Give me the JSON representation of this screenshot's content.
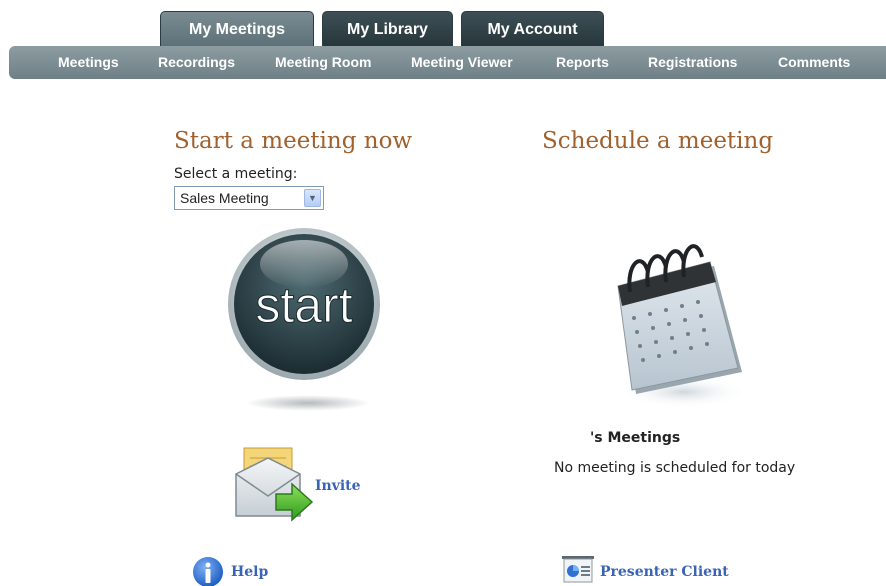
{
  "top_tabs": [
    {
      "label": "My Meetings",
      "active": true
    },
    {
      "label": "My Library",
      "active": false
    },
    {
      "label": "My Account",
      "active": false
    }
  ],
  "subnav": [
    "Meetings",
    "Recordings",
    "Meeting Room",
    "Meeting Viewer",
    "Reports",
    "Registrations",
    "Comments"
  ],
  "start_section": {
    "title": "Start a meeting now",
    "select_label": "Select a meeting:",
    "selected_meeting": "Sales Meeting",
    "start_button_text": "start"
  },
  "schedule_section": {
    "title": "Schedule a meeting",
    "meetings_title": "'s Meetings",
    "meetings_note": "No meeting is scheduled for today"
  },
  "links": {
    "invite": "Invite",
    "help": "Help",
    "presenter_client": "Presenter Client"
  },
  "colors": {
    "heading": "#a0612d",
    "link": "#3a63b5",
    "tab_dark": "#26363b",
    "subnav": "#7d8f95"
  },
  "icons": [
    "chevron-down-icon",
    "start-button-icon",
    "calendar-icon",
    "envelope-icon",
    "help-icon",
    "presenter-icon"
  ]
}
